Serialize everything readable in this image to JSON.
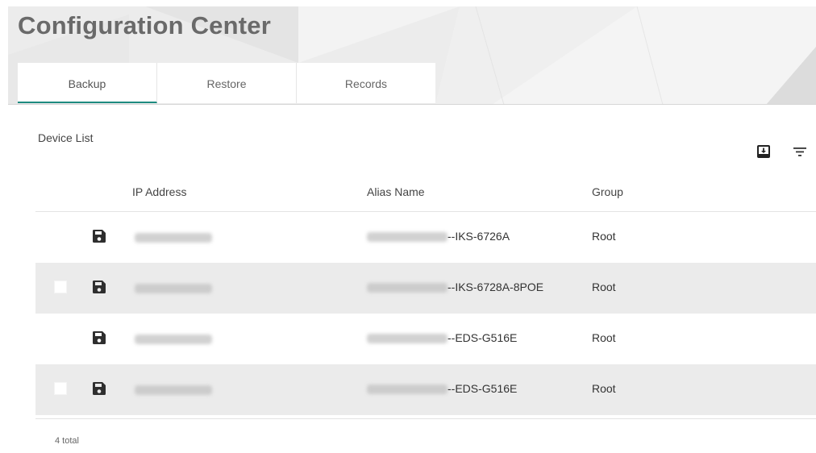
{
  "page": {
    "title": "Configuration Center"
  },
  "tabs": [
    {
      "label": "Backup",
      "active": true
    },
    {
      "label": "Restore",
      "active": false
    },
    {
      "label": "Records",
      "active": false
    }
  ],
  "device_list": {
    "title": "Device List",
    "toolbar_icons": [
      "export-icon",
      "filter-icon"
    ],
    "columns": [
      "IP Address",
      "Alias Name",
      "Group"
    ],
    "rows": [
      {
        "alias_suffix": "--IKS-6726A",
        "group": "Root",
        "checkbox_visible": false
      },
      {
        "alias_suffix": "--IKS-6728A-8POE",
        "group": "Root",
        "checkbox_visible": true
      },
      {
        "alias_suffix": "--EDS-G516E",
        "group": "Root",
        "checkbox_visible": false
      },
      {
        "alias_suffix": "--EDS-G516E",
        "group": "Root",
        "checkbox_visible": true
      }
    ],
    "row_icon": "save-icon",
    "total": "4 total"
  },
  "colors": {
    "accent": "#1e8b80",
    "row_shade": "#ebebeb",
    "header_bg": "#ececec"
  }
}
